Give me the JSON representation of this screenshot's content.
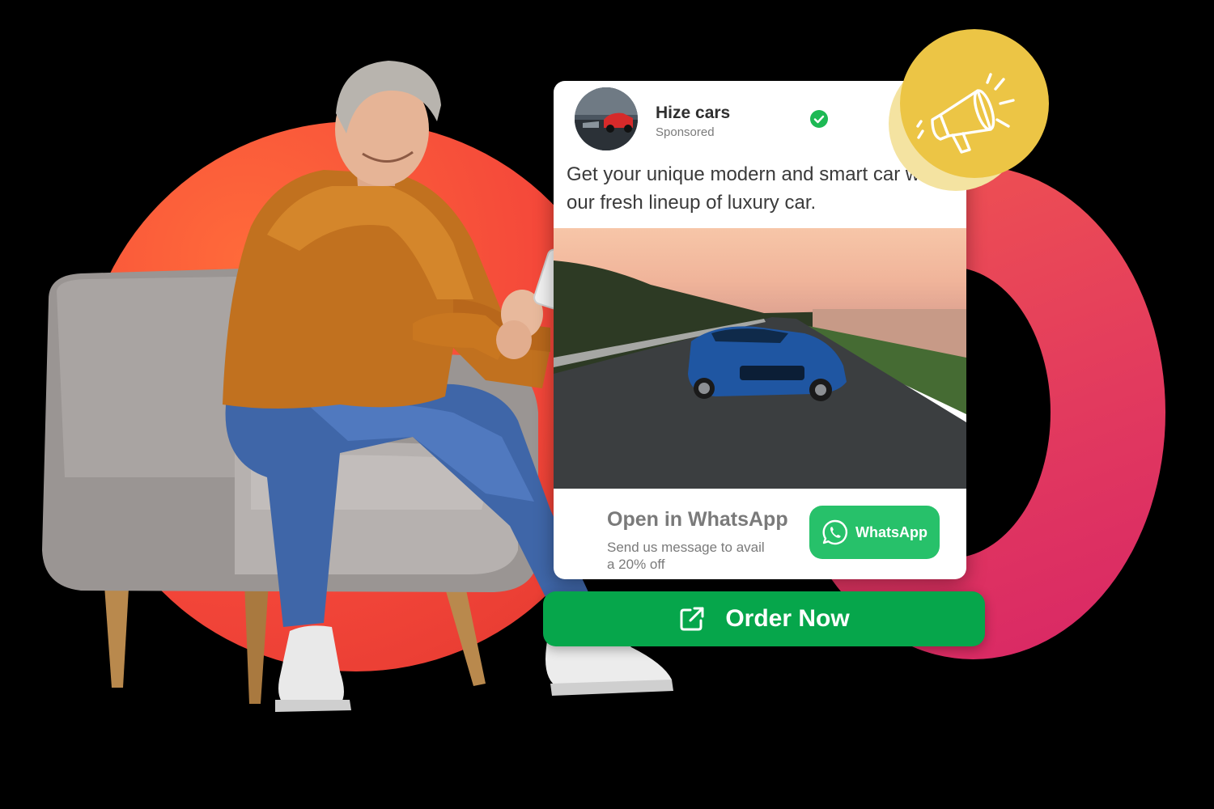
{
  "ad": {
    "brand_name": "Hize cars",
    "sponsored_label": "Sponsored",
    "copy": "Get your unique modern and smart car with our fresh lineup of luxury car.",
    "cta": {
      "title": "Open in WhatsApp",
      "subtitle": "Send us message to avail a 20% off",
      "button_label": "WhatsApp"
    }
  },
  "order_button": {
    "label": "Order Now"
  },
  "icons": {
    "verified": "check-circle-icon",
    "whatsapp": "whatsapp-icon",
    "megaphone": "megaphone-icon",
    "external_link": "external-link-icon"
  },
  "colors": {
    "whatsapp_green": "#27c16a",
    "order_green": "#06a64b",
    "verified_green": "#1db954",
    "ring_left": "#f4473a",
    "ring_right": "#d82666",
    "badge_yellow": "#ecc545"
  }
}
